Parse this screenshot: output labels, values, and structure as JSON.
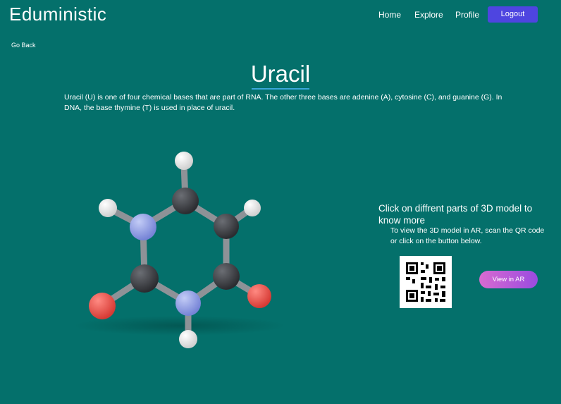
{
  "header": {
    "brand": "Eduministic",
    "nav": {
      "home": "Home",
      "explore": "Explore",
      "profile": "Profile"
    },
    "logout_label": "Logout"
  },
  "page": {
    "go_back": "Go Back",
    "title": "Uracil",
    "description": "Uracil (U) is one of four chemical bases that are part of RNA. The other three bases are adenine (A), cytosine (C), and guanine (G). In DNA, the base thymine (T) is used in place of uracil."
  },
  "side_panel": {
    "hint": "Click on diffrent parts of 3D model to know more",
    "ar_instructions": "To view the 3D model in AR, scan the QR code or click on the button below.",
    "ar_button": "View in AR"
  },
  "colors": {
    "background": "#04706b",
    "logout_bg": "#4e45e0",
    "carbon": "#3d3f44",
    "nitrogen": "#8a99e6",
    "oxygen": "#ef5a52",
    "hydrogen": "#f2f2f2"
  }
}
